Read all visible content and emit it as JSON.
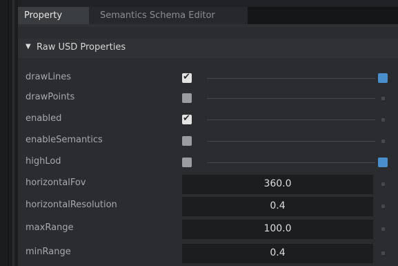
{
  "tabs": [
    {
      "label": "Property",
      "active": true
    },
    {
      "label": "Semantics Schema Editor",
      "active": false
    }
  ],
  "section": {
    "title": "Raw USD Properties",
    "expanded": true
  },
  "properties": [
    {
      "name": "drawLines",
      "type": "bool",
      "checked": true,
      "value": "",
      "modified": true
    },
    {
      "name": "drawPoints",
      "type": "bool",
      "checked": false,
      "value": "",
      "modified": false
    },
    {
      "name": "enabled",
      "type": "bool",
      "checked": true,
      "value": "",
      "modified": false
    },
    {
      "name": "enableSemantics",
      "type": "bool",
      "checked": false,
      "value": "",
      "modified": false
    },
    {
      "name": "highLod",
      "type": "bool",
      "checked": false,
      "value": "",
      "modified": true
    },
    {
      "name": "horizontalFov",
      "type": "float",
      "checked": false,
      "value": "360.0",
      "modified": false
    },
    {
      "name": "horizontalResolution",
      "type": "float",
      "checked": false,
      "value": "0.4",
      "modified": false
    },
    {
      "name": "maxRange",
      "type": "float",
      "checked": false,
      "value": "100.0",
      "modified": false
    },
    {
      "name": "minRange",
      "type": "float",
      "checked": false,
      "value": "0.4",
      "modified": false
    }
  ],
  "colors": {
    "accent": "#4a8fcc",
    "panel": "#2a2c2f",
    "field": "#1c1d1f"
  }
}
